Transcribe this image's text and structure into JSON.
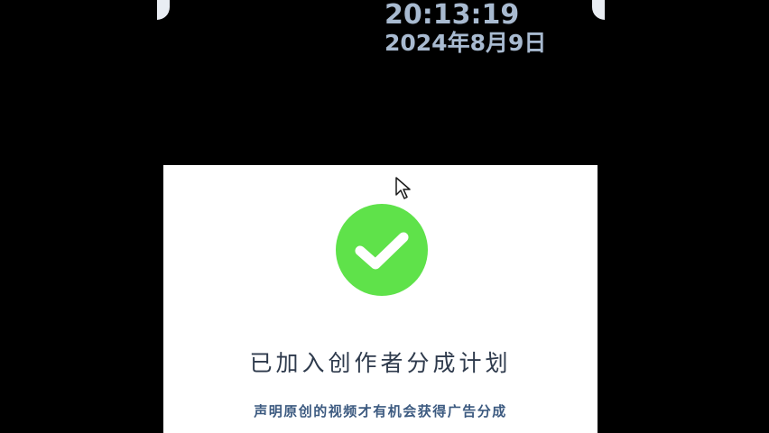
{
  "status_clock": {
    "time": "20:13:19",
    "date": "2024年8月9日"
  },
  "dialog": {
    "icon": "check-circle-icon",
    "accent_color": "#5fe24a",
    "title": "已加入创作者分成计划",
    "subtitle": "声明原创的视频才有机会获得广告分成"
  },
  "cursor": {
    "icon": "mouse-pointer-icon"
  }
}
